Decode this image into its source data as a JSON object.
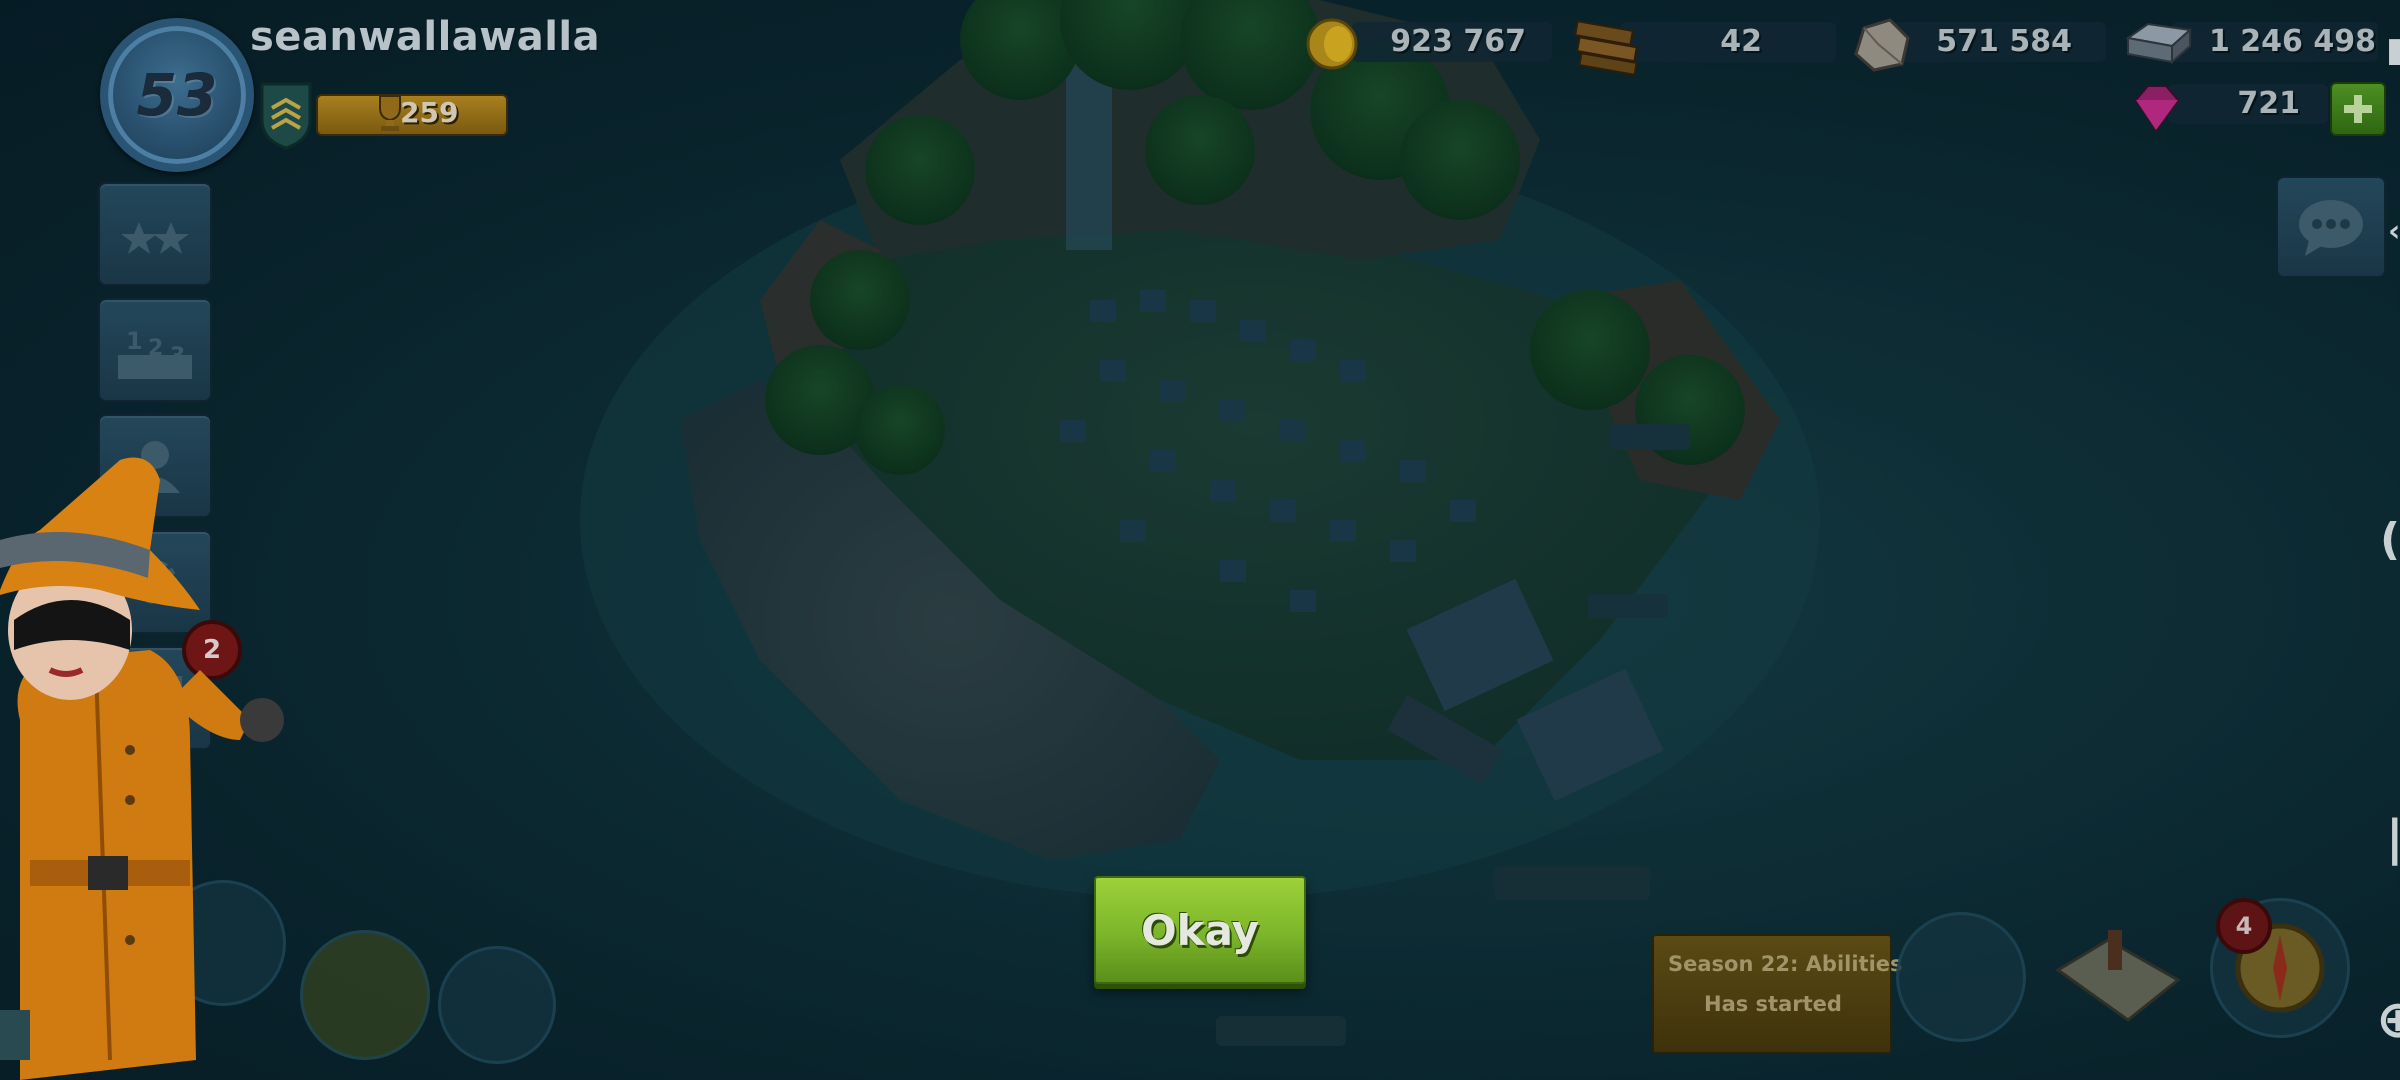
{
  "player": {
    "name": "seanwallawalla",
    "level": "53",
    "trophies": "259"
  },
  "resources": {
    "gold": "923 767",
    "wood": "42",
    "stone": "571 584",
    "iron": "1 246 498",
    "gems": "721"
  },
  "notifications": {
    "side_badge": "2",
    "reward_badge": "4"
  },
  "dialog": {
    "okay_label": "Okay"
  },
  "season": {
    "title": "Season 22: Abilities",
    "subtitle": "Has started"
  },
  "icons": {
    "level": "level-badge-icon",
    "rank": "rank-chevron-icon",
    "trophy": "trophy-icon",
    "gold": "gold-coin-icon",
    "wood": "wood-planks-icon",
    "stone": "stone-icon",
    "iron": "iron-ingot-icon",
    "gems": "gem-icon",
    "add": "plus-icon",
    "chat": "chat-bubble-icon",
    "leaderboard": "leaderboard-icon",
    "rank_stars": "stars-icon",
    "friends": "friends-icon",
    "settings": "settings-gear-icon",
    "news": "news-icon",
    "map": "map-icon",
    "compass": "compass-icon"
  },
  "colors": {
    "okay_green": "#7bb52a",
    "gold": "#c9a21f",
    "gem": "#b0287e",
    "ocean": "#123840"
  }
}
